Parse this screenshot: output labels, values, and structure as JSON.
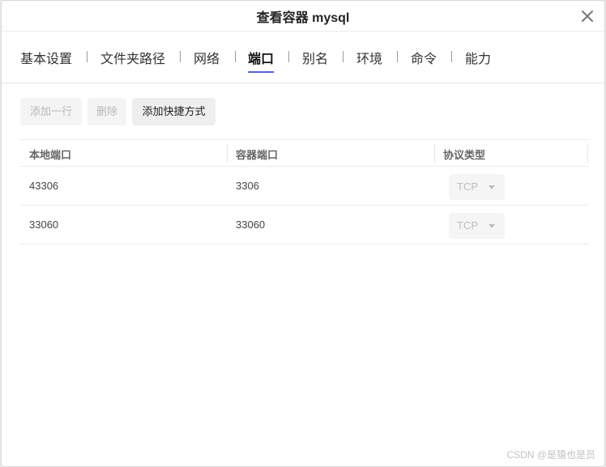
{
  "dialog": {
    "title": "查看容器 mysql"
  },
  "tabs": [
    {
      "label": "基本设置"
    },
    {
      "label": "文件夹路径"
    },
    {
      "label": "网络"
    },
    {
      "label": "端口",
      "active": true
    },
    {
      "label": "别名"
    },
    {
      "label": "环境"
    },
    {
      "label": "命令"
    },
    {
      "label": "能力"
    }
  ],
  "toolbar": {
    "add_row_label": "添加一行",
    "delete_label": "删除",
    "add_shortcut_label": "添加快捷方式"
  },
  "table": {
    "columns": [
      "本地端口",
      "容器端口",
      "协议类型"
    ],
    "rows": [
      {
        "local": "43306",
        "container": "3306",
        "protocol": "TCP"
      },
      {
        "local": "33060",
        "container": "33060",
        "protocol": "TCP"
      }
    ]
  },
  "watermark": "CSDN @是猿也是员",
  "colors": {
    "accent": "#5561d6",
    "disabled_text": "#b8b8b8"
  },
  "icons": {
    "close": "close-icon",
    "dropdown": "chevron-down-icon"
  }
}
